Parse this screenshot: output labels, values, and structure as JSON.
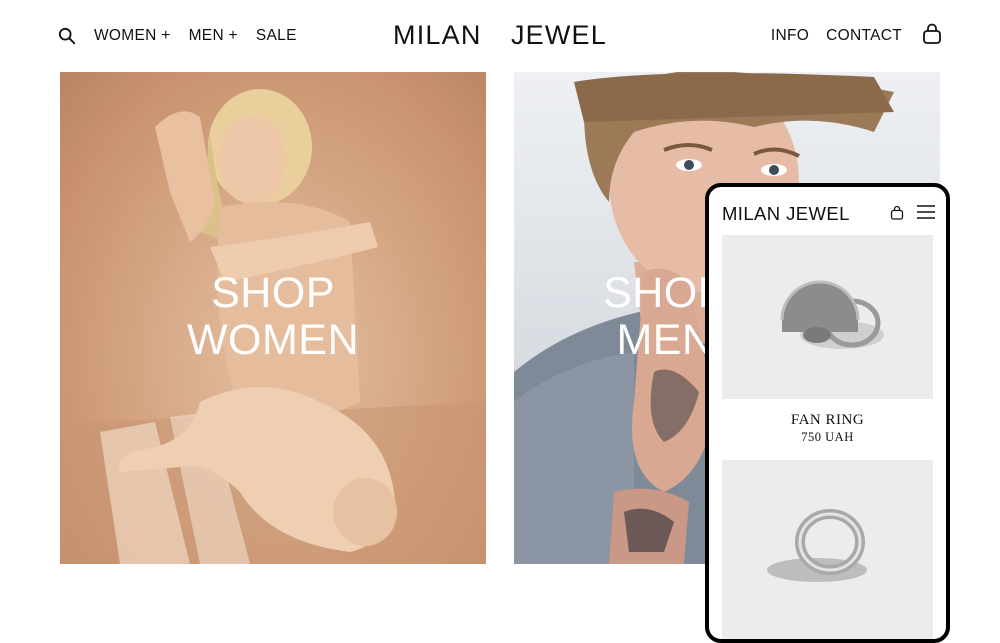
{
  "header": {
    "brand": "MILAN  JEWEL",
    "nav_left": [
      "WOMEN +",
      "MEN +",
      "SALE"
    ],
    "nav_right": [
      "INFO",
      "CONTACT"
    ]
  },
  "hero": {
    "women": {
      "line1": "SHOP",
      "line2": "WOMEN"
    },
    "men": {
      "line1": "SHOP",
      "line2": "MEN"
    }
  },
  "mobile": {
    "brand": "MILAN JEWEL",
    "products": [
      {
        "name": "FAN RING",
        "price": "750 UAH"
      }
    ]
  },
  "colors": {
    "women_bg": "#d9ac8b",
    "men_bg": "#dde1e6",
    "text": "#111111",
    "phone_frame": "#000000"
  }
}
